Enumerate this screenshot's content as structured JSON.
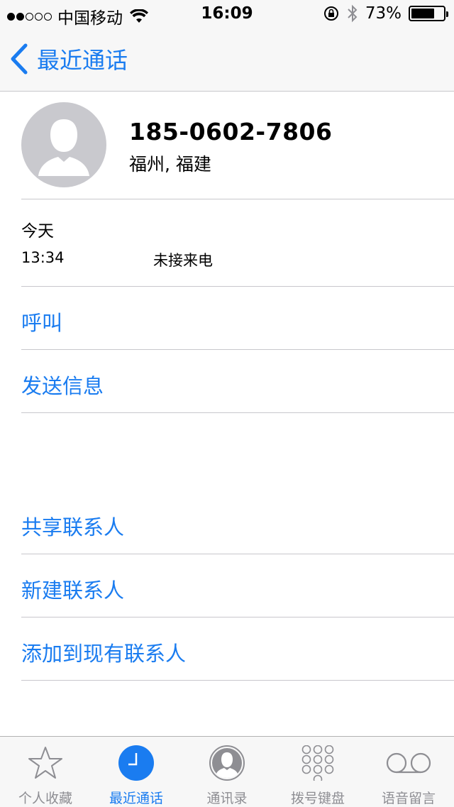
{
  "status_bar": {
    "carrier": "中国移动",
    "time": "16:09",
    "battery_percent": "73%",
    "battery_level": 0.73,
    "signal_bars": 2
  },
  "nav": {
    "back_label": "最近通话"
  },
  "contact": {
    "phone": "185-0602-7806",
    "location": "福州, 福建"
  },
  "call_log": {
    "day": "今天",
    "time": "13:34",
    "type": "未接来电"
  },
  "actions": {
    "call": "呼叫",
    "message": "发送信息",
    "share": "共享联系人",
    "new_contact": "新建联系人",
    "add_existing": "添加到现有联系人"
  },
  "tabs": [
    {
      "label": "个人收藏",
      "icon": "star-icon"
    },
    {
      "label": "最近通话",
      "icon": "clock-icon",
      "active": true
    },
    {
      "label": "通讯录",
      "icon": "contacts-icon"
    },
    {
      "label": "拨号键盘",
      "icon": "keypad-icon"
    },
    {
      "label": "语音留言",
      "icon": "voicemail-icon"
    }
  ],
  "colors": {
    "accent": "#1a7cf0",
    "inactive": "#8e8e93",
    "separator": "#c8c7cc"
  }
}
